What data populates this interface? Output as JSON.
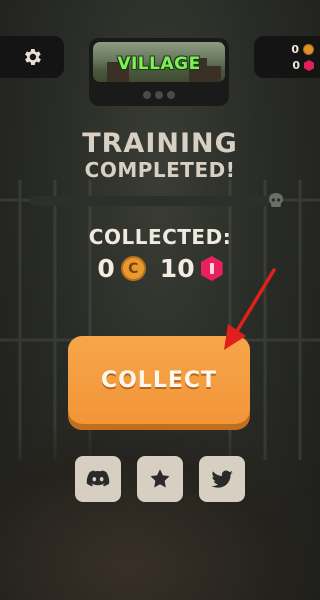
{
  "top_bar": {
    "settings_icon": "gear-icon",
    "level": {
      "name": "VILLAGE",
      "pages": 3
    },
    "currencies": [
      {
        "icon": "coin-icon",
        "value": "0"
      },
      {
        "icon": "gem-icon",
        "value": "0"
      }
    ]
  },
  "status": {
    "line1": "TRAINING",
    "line2": "COMPLETED!"
  },
  "progress": {
    "fraction": 0,
    "end_icon": "skull-icon"
  },
  "rewards": {
    "label": "COLLECTED:",
    "coins": "0",
    "gems": "10"
  },
  "collect_button": {
    "label": "COLLECT"
  },
  "social": [
    {
      "icon": "discord-icon"
    },
    {
      "icon": "star-icon"
    },
    {
      "icon": "twitter-icon"
    }
  ],
  "colors": {
    "accent_orange": "#f29538",
    "level_title_green": "#7ff05a",
    "gem_pink": "#e8215e",
    "coin_orange": "#e89a2e",
    "annotation_red": "#e0201a"
  }
}
